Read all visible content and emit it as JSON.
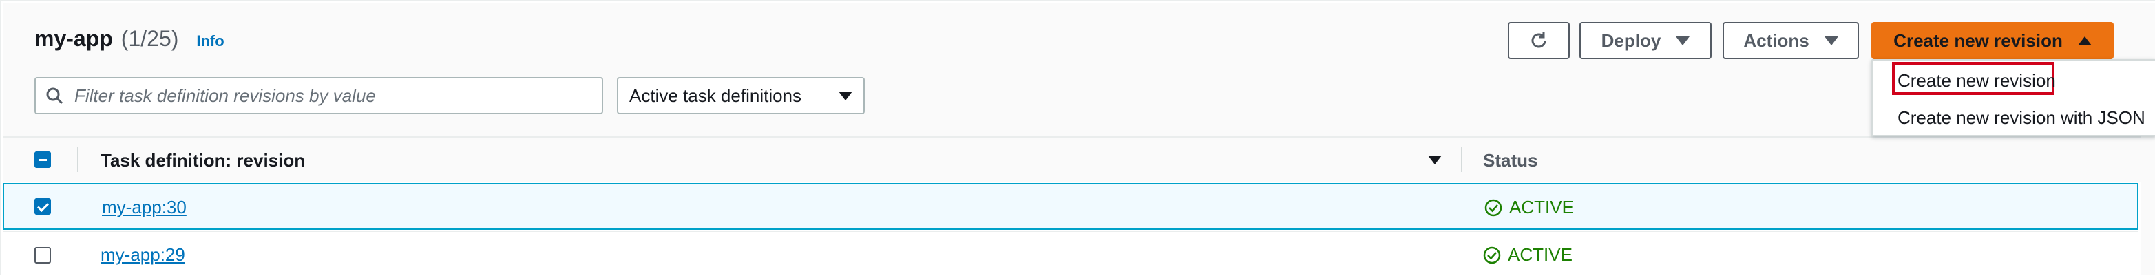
{
  "header": {
    "title": "my-app",
    "count": "(1/25)",
    "info_link": "Info"
  },
  "toolbar": {
    "refresh_icon": "refresh-icon",
    "deploy_label": "Deploy",
    "actions_label": "Actions",
    "create_label": "Create new revision"
  },
  "filter": {
    "search_placeholder": "Filter task definition revisions by value",
    "select_value": "Active task definitions"
  },
  "table": {
    "columns": [
      "Task definition: revision",
      "Status"
    ],
    "rows": [
      {
        "revision": "my-app:30",
        "status": "ACTIVE",
        "selected": true
      },
      {
        "revision": "my-app:29",
        "status": "ACTIVE",
        "selected": false
      }
    ]
  },
  "dropdown_menu": {
    "items": [
      "Create new revision",
      "Create new revision with JSON"
    ]
  },
  "colors": {
    "primary": "#ec7211",
    "link": "#0073bb",
    "success": "#1d8102",
    "highlight": "#d0021b"
  }
}
